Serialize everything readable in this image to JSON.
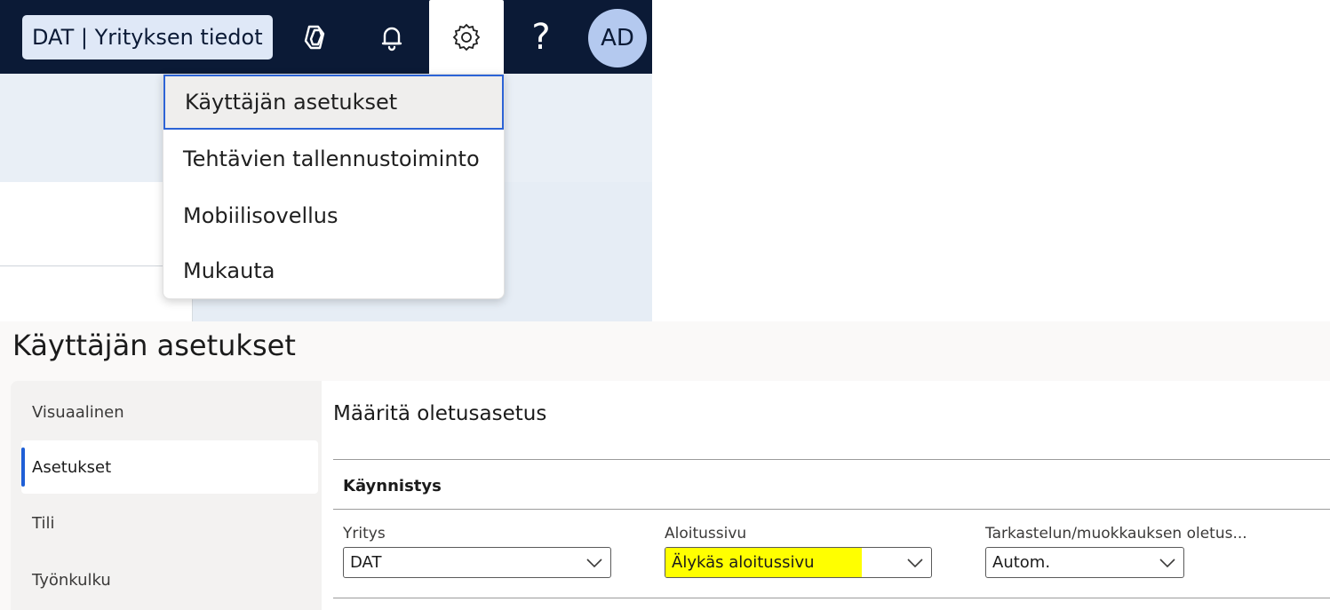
{
  "header": {
    "company": "DAT | Yrityksen tiedot",
    "icons": [
      "copilot-icon",
      "bell-icon",
      "gear-icon",
      "help-icon"
    ],
    "help_glyph": "?",
    "avatar_initials": "AD",
    "colors": {
      "navbar": "#0b1a36",
      "chip": "#dfe8f7",
      "avatar": "#b4c9ef"
    }
  },
  "settings_menu": {
    "items": [
      {
        "label": "Käyttäjän asetukset",
        "selected": true
      },
      {
        "label": "Tehtävien tallennustoiminto",
        "selected": false
      },
      {
        "label": "Mobiilisovellus",
        "selected": false
      },
      {
        "label": "Mukauta",
        "selected": false
      }
    ],
    "selection_border_color": "#2c63d6"
  },
  "user_settings": {
    "title": "Käyttäjän asetukset",
    "nav": [
      {
        "label": "Visuaalinen",
        "active": false
      },
      {
        "label": "Asetukset",
        "active": true
      },
      {
        "label": "Tili",
        "active": false
      },
      {
        "label": "Työnkulku",
        "active": false
      }
    ],
    "section_title": "Määritä oletusasetus",
    "group_title": "Käynnistys",
    "fields": [
      {
        "label": "Yritys",
        "value": "DAT"
      },
      {
        "label": "Aloitussivu",
        "value": "Älykäs aloitussivu",
        "highlight": "#ffff00"
      },
      {
        "label": "Tarkastelun/muokkauksen oletus...",
        "value": "Autom."
      }
    ],
    "accent_color": "#1f5fd6"
  }
}
